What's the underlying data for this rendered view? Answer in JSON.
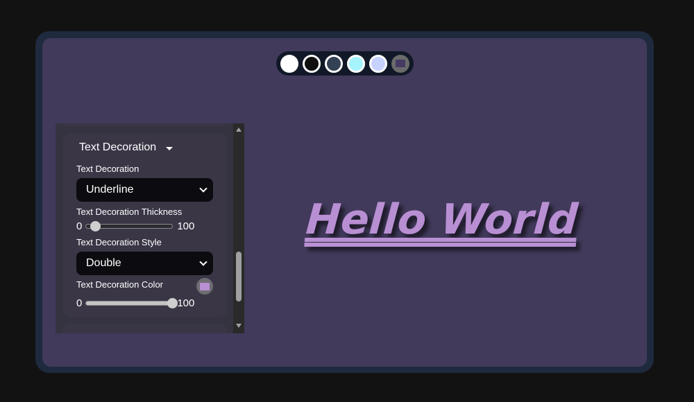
{
  "swatches": [
    {
      "name": "white",
      "color": "#ffffff"
    },
    {
      "name": "black",
      "color": "#0f0f10"
    },
    {
      "name": "slate",
      "color": "#334155"
    },
    {
      "name": "cyan",
      "color": "#a5f3fc"
    },
    {
      "name": "indigo",
      "color": "#c7d2fe"
    },
    {
      "name": "custom",
      "color": "#453b62"
    }
  ],
  "panel": {
    "section_title": "Text Decoration",
    "decoration": {
      "label": "Text Decoration",
      "value": "Underline"
    },
    "thickness": {
      "label": "Text Decoration Thickness",
      "min": "0",
      "max": "100",
      "value": 10
    },
    "style": {
      "label": "Text Decoration Style",
      "value": "Double"
    },
    "color": {
      "label": "Text Decoration Color",
      "swatch": "#b98fd3",
      "min": "0",
      "max": "100",
      "opacity": 100
    }
  },
  "preview": {
    "text": "Hello World",
    "color": "#b98fd3"
  }
}
